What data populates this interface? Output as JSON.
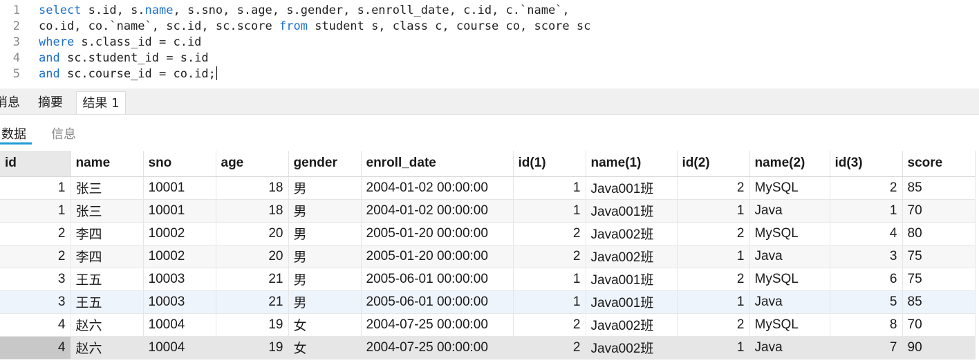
{
  "editor": {
    "lines": [
      {
        "n": "1",
        "parts": [
          [
            "kw",
            "select"
          ],
          [
            "t",
            " s.id, s."
          ],
          [
            "kw",
            "name"
          ],
          [
            "t",
            ", s.sno, s.age, s.gender, s.enroll_date, c.id, c.`name`,"
          ]
        ]
      },
      {
        "n": "2",
        "parts": [
          [
            "t",
            "co.id, co.`name`, sc.id, sc.score "
          ],
          [
            "kw",
            "from"
          ],
          [
            "t",
            " student s, class c, course co, score sc"
          ]
        ]
      },
      {
        "n": "3",
        "parts": [
          [
            "kw",
            "where"
          ],
          [
            "t",
            " s.class_id = c.id"
          ]
        ]
      },
      {
        "n": "4",
        "parts": [
          [
            "kw",
            "and"
          ],
          [
            "t",
            " sc.student_id = s.id"
          ]
        ]
      },
      {
        "n": "5",
        "parts": [
          [
            "kw",
            "and"
          ],
          [
            "t",
            " sc.course_id = co.id;"
          ]
        ]
      }
    ]
  },
  "tabs": {
    "messages": "消息",
    "summary": "摘要",
    "result": "结果 1"
  },
  "subtabs": {
    "data": "数据",
    "info": "信息"
  },
  "grid": {
    "columns": [
      "id",
      "name",
      "sno",
      "age",
      "gender",
      "enroll_date",
      "id(1)",
      "name(1)",
      "id(2)",
      "name(2)",
      "id(3)",
      "score"
    ],
    "rows": [
      [
        "1",
        "张三",
        "10001",
        "18",
        "男",
        "2004-01-02 00:00:00",
        "1",
        "Java001班",
        "2",
        "MySQL",
        "2",
        "85"
      ],
      [
        "1",
        "张三",
        "10001",
        "18",
        "男",
        "2004-01-02 00:00:00",
        "1",
        "Java001班",
        "1",
        "Java",
        "1",
        "70"
      ],
      [
        "2",
        "李四",
        "10002",
        "20",
        "男",
        "2005-01-20 00:00:00",
        "2",
        "Java002班",
        "2",
        "MySQL",
        "4",
        "80"
      ],
      [
        "2",
        "李四",
        "10002",
        "20",
        "男",
        "2005-01-20 00:00:00",
        "2",
        "Java002班",
        "1",
        "Java",
        "3",
        "75"
      ],
      [
        "3",
        "王五",
        "10003",
        "21",
        "男",
        "2005-06-01 00:00:00",
        "1",
        "Java001班",
        "2",
        "MySQL",
        "6",
        "75"
      ],
      [
        "3",
        "王五",
        "10003",
        "21",
        "男",
        "2005-06-01 00:00:00",
        "1",
        "Java001班",
        "1",
        "Java",
        "5",
        "85"
      ],
      [
        "4",
        "赵六",
        "10004",
        "19",
        "女",
        "2004-07-25 00:00:00",
        "2",
        "Java002班",
        "2",
        "MySQL",
        "8",
        "70"
      ],
      [
        "4",
        "赵六",
        "10004",
        "19",
        "女",
        "2004-07-25 00:00:00",
        "2",
        "Java002班",
        "1",
        "Java",
        "7",
        "90"
      ]
    ]
  }
}
